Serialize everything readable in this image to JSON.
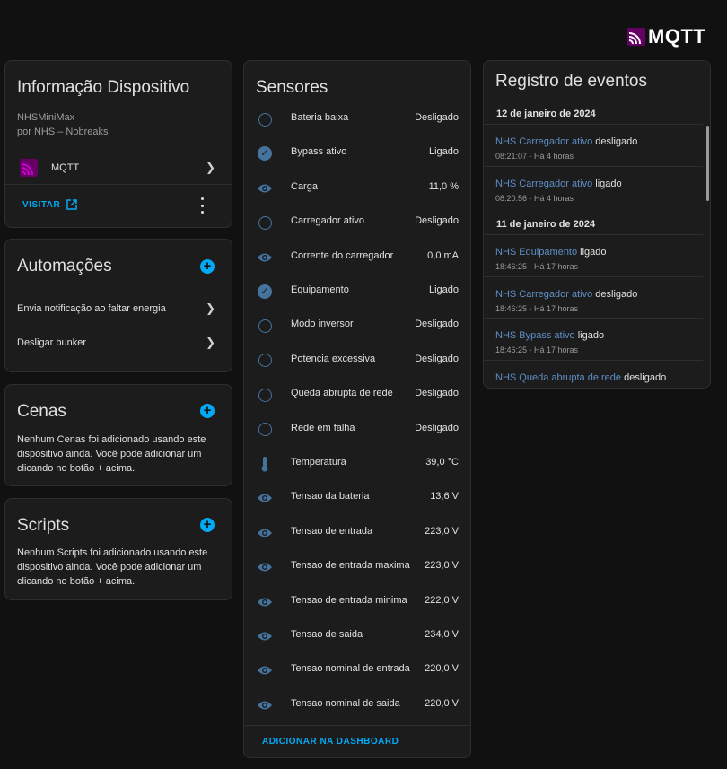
{
  "brand": {
    "name": "MQTT"
  },
  "device_card": {
    "title": "Informação Dispositivo",
    "model": "NHSMiniMax",
    "manufacturer": "por NHS – Nobreaks",
    "integration": "MQTT",
    "visit_label": "VISITAR"
  },
  "automations": {
    "title": "Automações",
    "items": [
      {
        "label": "Envia notificação ao faltar energia"
      },
      {
        "label": "Desligar bunker"
      }
    ]
  },
  "scenes": {
    "title": "Cenas",
    "empty_text": "Nenhum Cenas foi adicionado usando este dispositivo ainda. Você pode adicionar um clicando no botão + acima."
  },
  "scripts": {
    "title": "Scripts",
    "empty_text": "Nenhum Scripts foi adicionado usando este dispositivo ainda. Você pode adicionar um clicando no botão + acima."
  },
  "sensors": {
    "title": "Sensores",
    "items": [
      {
        "name": "Bateria baixa",
        "value": "Desligado",
        "icon": "circle-outline"
      },
      {
        "name": "Bypass ativo",
        "value": "Ligado",
        "icon": "check-circle"
      },
      {
        "name": "Carga",
        "value": "11,0 %",
        "icon": "eye"
      },
      {
        "name": "Carregador ativo",
        "value": "Desligado",
        "icon": "circle-outline"
      },
      {
        "name": "Corrente do carregador",
        "value": "0,0 mA",
        "icon": "eye"
      },
      {
        "name": "Equipamento",
        "value": "Ligado",
        "icon": "check-circle"
      },
      {
        "name": "Modo inversor",
        "value": "Desligado",
        "icon": "circle-outline"
      },
      {
        "name": "Potencia excessiva",
        "value": "Desligado",
        "icon": "circle-outline"
      },
      {
        "name": "Queda abrupta de rede",
        "value": "Desligado",
        "icon": "circle-outline"
      },
      {
        "name": "Rede em falha",
        "value": "Desligado",
        "icon": "circle-outline"
      },
      {
        "name": "Temperatura",
        "value": "39,0 °C",
        "icon": "thermometer"
      },
      {
        "name": "Tensao da bateria",
        "value": "13,6 V",
        "icon": "eye"
      },
      {
        "name": "Tensao de entrada",
        "value": "223,0 V",
        "icon": "eye"
      },
      {
        "name": "Tensao de entrada maxima",
        "value": "223,0 V",
        "icon": "eye"
      },
      {
        "name": "Tensao de entrada minima",
        "value": "222,0 V",
        "icon": "eye"
      },
      {
        "name": "Tensao de saida",
        "value": "234,0 V",
        "icon": "eye"
      },
      {
        "name": "Tensao nominal de entrada",
        "value": "220,0 V",
        "icon": "eye"
      },
      {
        "name": "Tensao nominal de saida",
        "value": "220,0 V",
        "icon": "eye"
      }
    ],
    "add_label": "ADICIONAR NA DASHBOARD"
  },
  "logbook": {
    "title": "Registro de eventos",
    "groups": [
      {
        "date": "12 de janeiro de 2024",
        "events": [
          {
            "entity": "NHS Carregador ativo",
            "state": "desligado",
            "time": "08:21:07 - Há 4 horas"
          },
          {
            "entity": "NHS Carregador ativo",
            "state": "ligado",
            "time": "08:20:56 - Há 4 horas"
          }
        ]
      },
      {
        "date": "11 de janeiro de 2024",
        "events": [
          {
            "entity": "NHS Equipamento",
            "state": "ligado",
            "time": "18:46:25 - Há 17 horas"
          },
          {
            "entity": "NHS Carregador ativo",
            "state": "desligado",
            "time": "18:46:25 - Há 17 horas"
          },
          {
            "entity": "NHS Bypass ativo",
            "state": "ligado",
            "time": "18:46:25 - Há 17 horas"
          },
          {
            "entity": "NHS Queda abrupta de rede",
            "state": "desligado",
            "time": ""
          }
        ]
      }
    ]
  },
  "colors": {
    "accent": "#03a9f4",
    "icon": "#44739e",
    "link": "#5e8fc7",
    "mqtt": "#660066"
  }
}
